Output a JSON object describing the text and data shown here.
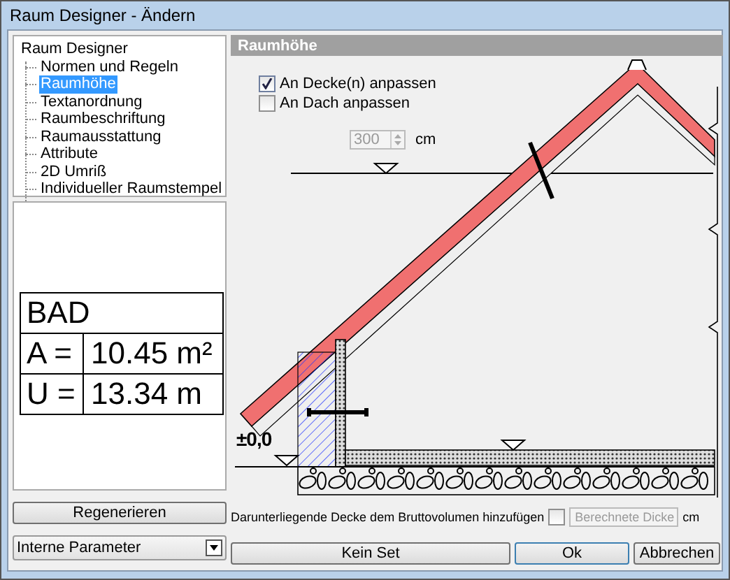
{
  "window": {
    "title": "Raum Designer - Ändern"
  },
  "tree": {
    "label": "Raum Designer",
    "selected": false,
    "children": [
      {
        "label": "Normen und Regeln",
        "selected": false
      },
      {
        "label": "Raumhöhe",
        "selected": true
      },
      {
        "label": "Textanordnung",
        "selected": false
      },
      {
        "label": "Raumbeschriftung",
        "selected": false
      },
      {
        "label": "Raumausstattung",
        "selected": false
      },
      {
        "label": "Attribute",
        "selected": false
      },
      {
        "label": "2D Umriß",
        "selected": false
      },
      {
        "label": "Individueller Raumstempel",
        "selected": false
      }
    ]
  },
  "preview": {
    "name": "BAD",
    "rows": [
      {
        "label": "A =",
        "value": "10.45 m²"
      },
      {
        "label": "U =",
        "value": "13.34 m"
      }
    ]
  },
  "regenerate_button": "Regenerieren",
  "parameter_select": {
    "value": "Interne Parameter"
  },
  "section": {
    "title": "Raumhöhe",
    "options": [
      {
        "label": "An Decke(n) anpassen",
        "checked": true
      },
      {
        "label": "An Dach anpassen",
        "checked": false
      }
    ],
    "height_field": {
      "value": "300",
      "unit": "cm",
      "disabled": true
    },
    "level_label": "±0,0",
    "floor_option": {
      "label": "Darunterliegende Decke dem Bruttovolumen hinzufügen",
      "checked": false
    },
    "thickness_select": {
      "value": "Berechnete Dicke",
      "unit": "cm",
      "disabled": true
    }
  },
  "buttons": [
    "Kein Set",
    "Ok",
    "Abbrechen"
  ]
}
